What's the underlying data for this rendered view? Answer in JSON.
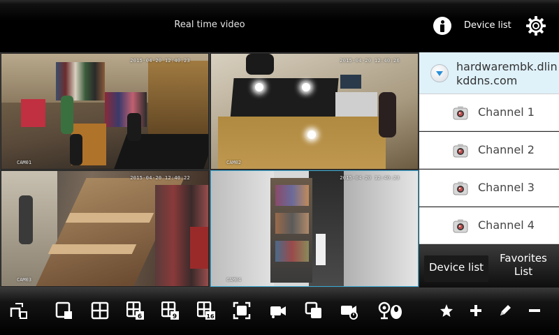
{
  "header": {
    "title": "Real time video",
    "device_list_label": "Device list"
  },
  "cameras": [
    {
      "label": "CAM01",
      "timestamp": "2015-04-20 12:40:23"
    },
    {
      "label": "CAM02",
      "timestamp": "2015-04-20 12:40:26"
    },
    {
      "label": "CAM03",
      "timestamp": "2015-04-20 12:40:22"
    },
    {
      "label": "CAM04",
      "timestamp": "2015-04-20 12:40:23"
    }
  ],
  "panel": {
    "host": "hardwarembk.dlinkddns.com",
    "channels": [
      "Channel 1",
      "Channel 2",
      "Channel 3",
      "Channel 4"
    ],
    "tab_device_list": "Device list",
    "tab_favorites": "Favorites List"
  },
  "toolbar": {
    "icons": [
      "switch-view-icon",
      "single-view-icon",
      "quad-view-icon",
      "six-view-icon",
      "nine-view-icon",
      "sixteen-view-icon",
      "fullscreen-icon",
      "record-icon",
      "snapshot-icon",
      "playback-icon",
      "ptz-icon",
      "favorite-star-icon",
      "add-icon",
      "edit-icon",
      "remove-icon"
    ],
    "grid_counts": [
      "6",
      "9",
      "16"
    ]
  },
  "colors": {
    "selected_border": "#39a9d6",
    "host_row_bg": "#dff1f9",
    "expand_arrow": "#2a8fd8"
  }
}
